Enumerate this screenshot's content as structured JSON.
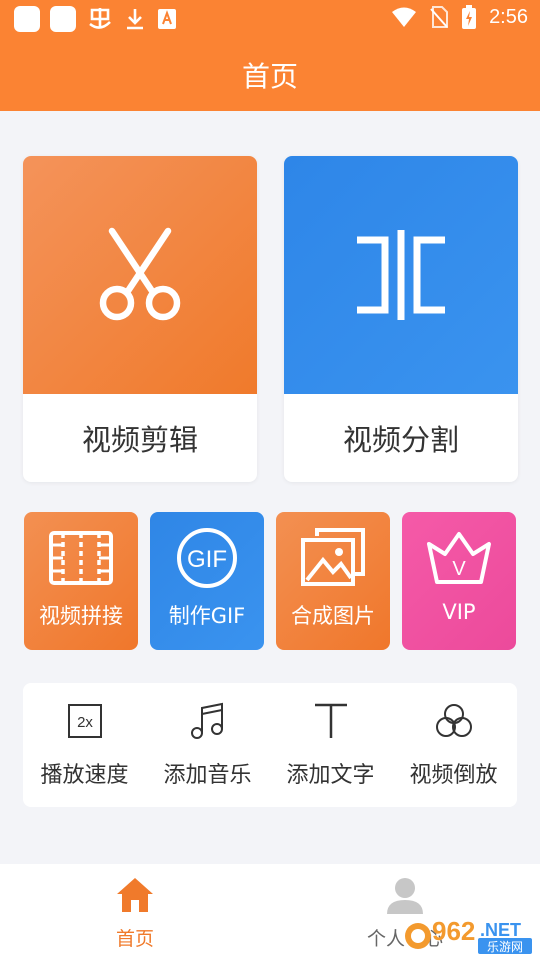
{
  "status_bar": {
    "time": "2:56"
  },
  "header": {
    "title": "首页"
  },
  "main_cards": [
    {
      "label": "视频剪辑",
      "icon": "scissors-icon"
    },
    {
      "label": "视频分割",
      "icon": "split-icon"
    }
  ],
  "feature_tiles": [
    {
      "label": "视频拼接",
      "icon": "film-strip-icon"
    },
    {
      "label": "制作GIF",
      "icon": "gif-icon",
      "icon_text": "GIF"
    },
    {
      "label": "合成图片",
      "icon": "image-stack-icon"
    },
    {
      "label": "VIP",
      "icon": "crown-icon",
      "icon_text": "V"
    }
  ],
  "tools": [
    {
      "label": "播放速度",
      "icon": "speed-icon",
      "icon_text": "2x"
    },
    {
      "label": "添加音乐",
      "icon": "music-note-icon"
    },
    {
      "label": "添加文字",
      "icon": "text-icon"
    },
    {
      "label": "视频倒放",
      "icon": "reverse-icon"
    }
  ],
  "bottom_nav": [
    {
      "label": "首页",
      "icon": "home-icon",
      "active": true
    },
    {
      "label": "个人中心",
      "icon": "person-icon",
      "active": false
    }
  ],
  "watermark": {
    "brand_number": "962",
    "brand_suffix": ".NET",
    "brand_cn": "乐游网"
  },
  "colors": {
    "primary": "#fb8333",
    "orange_card": "#f07a2b",
    "blue_card": "#2e86e8",
    "vip_pink": "#ec4a9b",
    "background": "#f3f4f8"
  }
}
